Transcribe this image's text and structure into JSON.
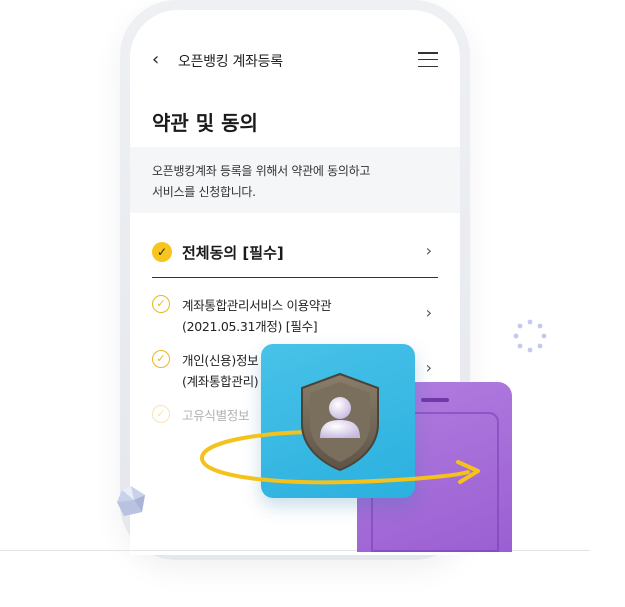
{
  "nav": {
    "back_icon": "chevron-left-icon",
    "title": "오픈뱅킹 계좌등록",
    "menu_icon": "hamburger-menu-icon"
  },
  "page_title": "약관 및 동의",
  "notice": {
    "line1": "오픈뱅킹계좌 등록을 위해서 약관에 동의하고",
    "line2": "서비스를 신청합니다."
  },
  "agree_all": {
    "label": "전체동의 [필수]",
    "checked": true
  },
  "terms": [
    {
      "line1": "계좌통합관리서비스 이용약관",
      "line2": "(2021.05.31개정) [필수]",
      "checked": true
    },
    {
      "line1": "개인(신용)정보",
      "line2": "(계좌통합관리)",
      "checked": true
    },
    {
      "line1": "고유식별정보",
      "line2": "",
      "checked": true
    }
  ],
  "colors": {
    "accent_yellow": "#f7c51e",
    "blue_card": "#3bb9e4",
    "purple_card": "#a66cd9",
    "shield": "#6f6556"
  }
}
